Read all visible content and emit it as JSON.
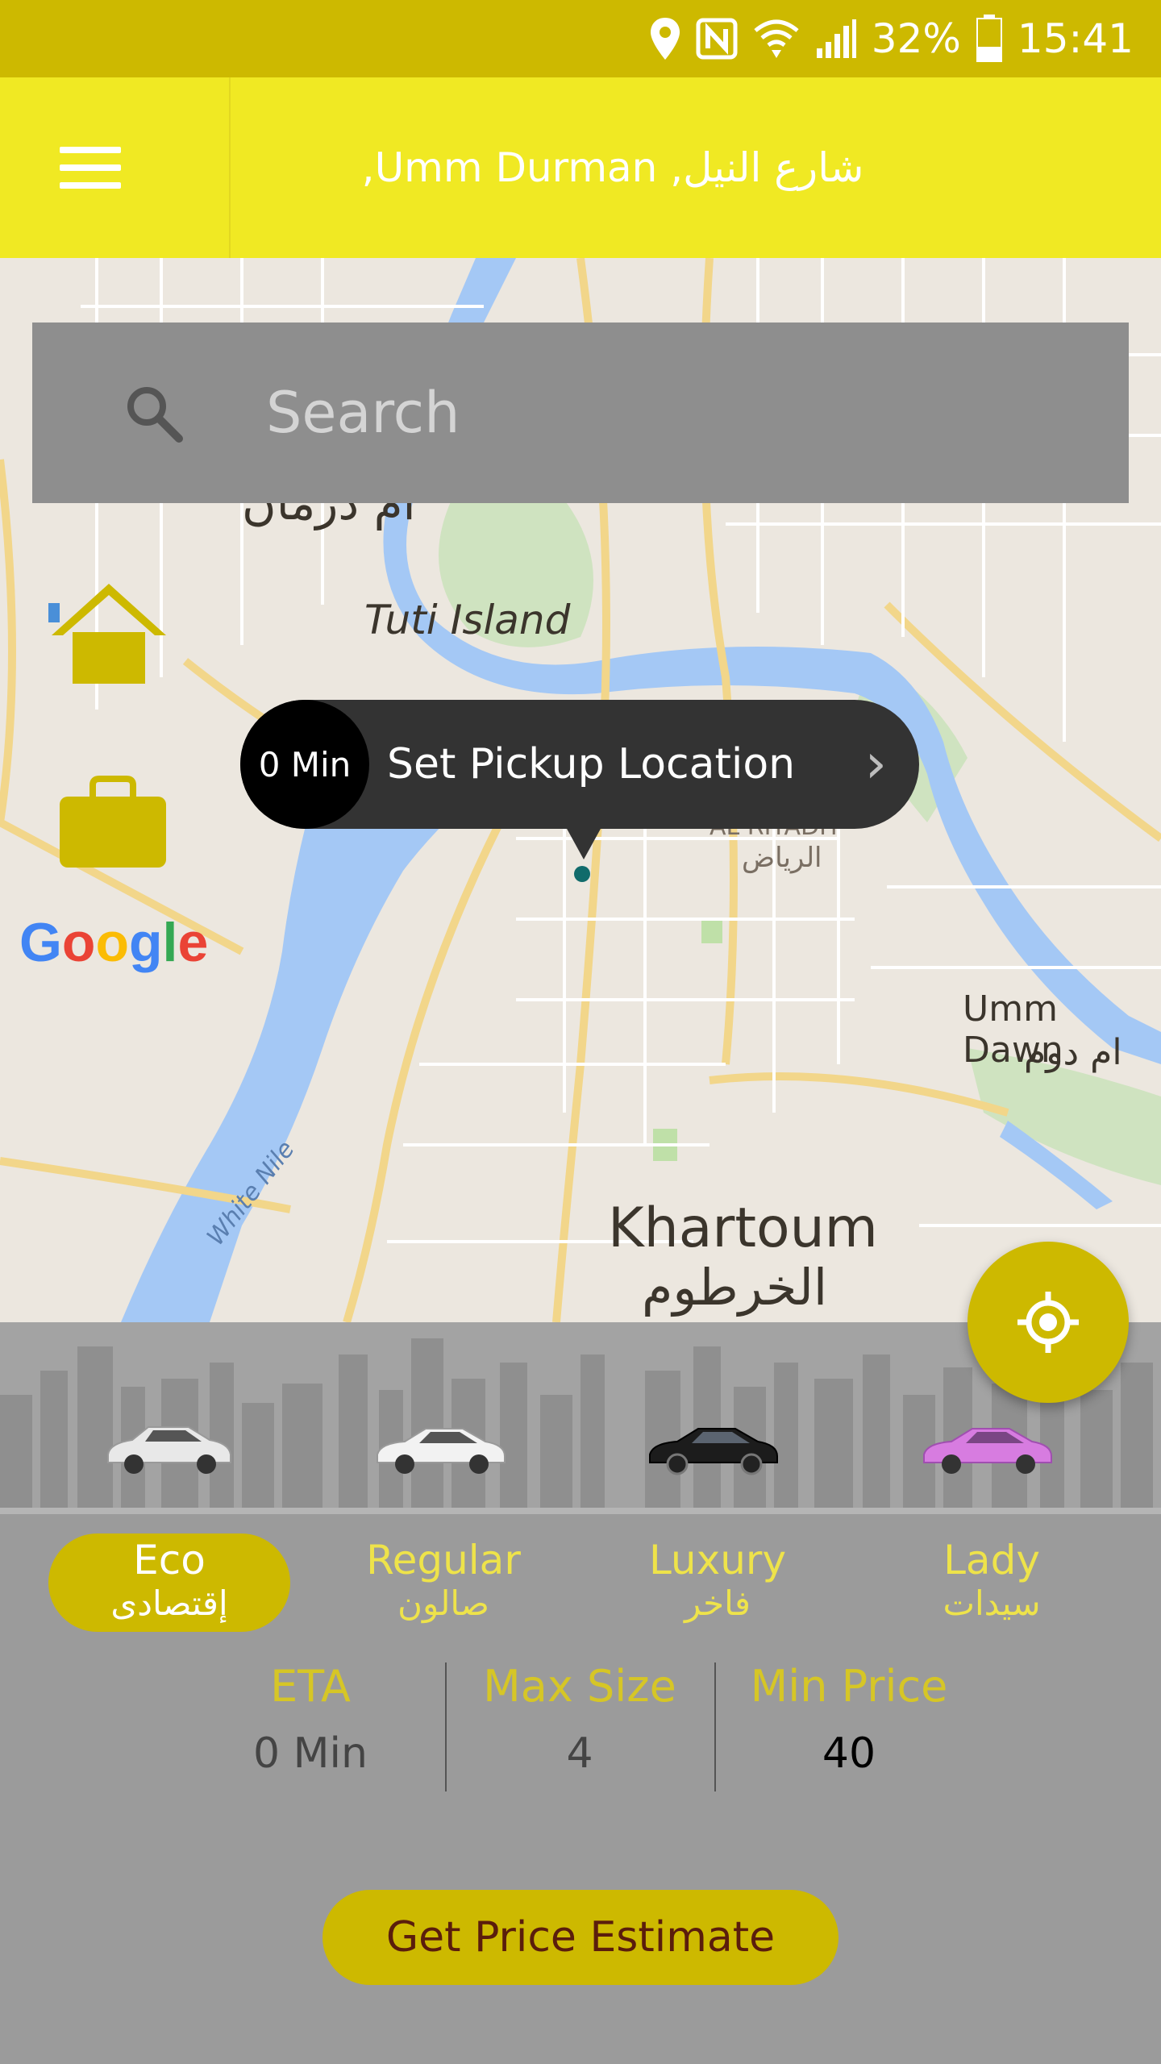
{
  "status_bar": {
    "battery": "32%",
    "time": "15:41",
    "icons": [
      "location-icon",
      "nfc-icon",
      "wifi-icon",
      "signal-icon",
      "battery-icon"
    ]
  },
  "header": {
    "menu_icon": "hamburger-menu-icon",
    "address": "شارع النيل, Umm Durman,"
  },
  "map": {
    "labels": {
      "umm_durman_ar": "أم درمان",
      "tuti_island": "Tuti Island",
      "al_riyadh_en": "AL RIYADH",
      "al_riyadh_ar": "الرياض",
      "umm_dawn_en": "Umm Dawn",
      "umm_dawn_ar": "ام دوم",
      "khartoum_en": "Khartoum",
      "khartoum_ar": "الخرطوم",
      "white_nile": "White Nile"
    },
    "google_logo": "Google",
    "search": {
      "placeholder": "Search",
      "icon": "search-icon"
    },
    "shortcuts": [
      "home-icon",
      "briefcase-icon"
    ],
    "pickup": {
      "eta": "0 Min",
      "label": "Set Pickup Location",
      "arrow": "›"
    },
    "locate_icon": "my-location-icon"
  },
  "car_types": [
    {
      "en": "Eco",
      "ar": "إقتصادى",
      "selected": true,
      "color": "#e8e8e8"
    },
    {
      "en": "Regular",
      "ar": "صالون",
      "selected": false,
      "color": "#f2f2f2"
    },
    {
      "en": "Luxury",
      "ar": "فاخر",
      "selected": false,
      "color": "#1c1c1c"
    },
    {
      "en": "Lady",
      "ar": "سيدات",
      "selected": false,
      "color": "#d77ce0"
    }
  ],
  "stats": {
    "eta_label": "ETA",
    "eta_value": "0 Min",
    "max_size_label": "Max Size",
    "max_size_value": "4",
    "min_price_label": "Min Price",
    "min_price_value": "40"
  },
  "actions": {
    "estimate_label": "Get Price Estimate"
  },
  "colors": {
    "accent": "#cdb900",
    "header_bg": "#f0e923",
    "panel_bg": "#9b9b9b",
    "label_yellow": "#d6c626"
  }
}
